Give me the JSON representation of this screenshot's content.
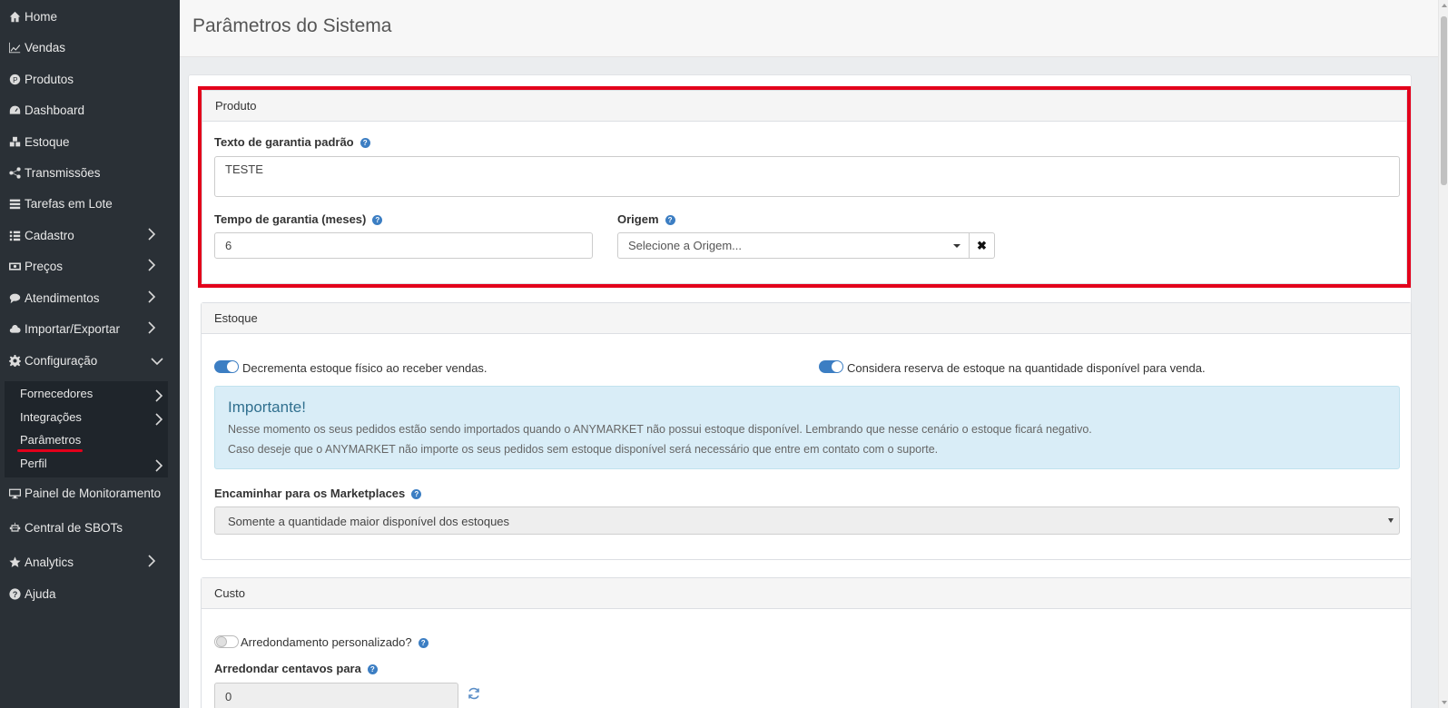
{
  "sidebar": {
    "items": [
      {
        "label": "Home",
        "icon": "home-icon"
      },
      {
        "label": "Vendas",
        "icon": "chart-line-icon"
      },
      {
        "label": "Produtos",
        "icon": "product-icon"
      },
      {
        "label": "Dashboard",
        "icon": "dashboard-icon"
      },
      {
        "label": "Estoque",
        "icon": "cubes-icon"
      },
      {
        "label": "Transmissões",
        "icon": "share-icon"
      },
      {
        "label": "Tarefas em Lote",
        "icon": "list-icon"
      },
      {
        "label": "Cadastro",
        "icon": "list-ul-icon"
      },
      {
        "label": "Preços",
        "icon": "money-icon"
      },
      {
        "label": "Atendimentos",
        "icon": "comment-icon"
      },
      {
        "label": "Importar/Exportar",
        "icon": "cloud-icon"
      },
      {
        "label": "Configuração",
        "icon": "gear-icon"
      },
      {
        "label": "Painel de Monitoramento",
        "icon": "monitor-icon"
      },
      {
        "label": "Central de SBOTs",
        "icon": "robot-icon"
      },
      {
        "label": "Analytics",
        "icon": "star-icon"
      },
      {
        "label": "Ajuda",
        "icon": "question-icon"
      }
    ],
    "submenu": [
      {
        "label": "Fornecedores"
      },
      {
        "label": "Integrações"
      },
      {
        "label": "Parâmetros"
      },
      {
        "label": "Perfil"
      }
    ]
  },
  "header": {
    "title": "Parâmetros do Sistema"
  },
  "produto": {
    "heading": "Produto",
    "garantia_texto_label": "Texto de garantia padrão",
    "garantia_texto_value": "TESTE",
    "tempo_garantia_label": "Tempo de garantia (meses)",
    "tempo_garantia_value": "6",
    "origem_label": "Origem",
    "origem_placeholder": "Selecione a Origem..."
  },
  "estoque": {
    "heading": "Estoque",
    "toggle1_label": "Decrementa estoque físico ao receber vendas.",
    "toggle2_label": "Considera reserva de estoque na quantidade disponível para venda.",
    "alert_title": "Importante!",
    "alert_line1": "Nesse momento os seus pedidos estão sendo importados quando o ANYMARKET não possui estoque disponível. Lembrando que nesse cenário o estoque ficará negativo.",
    "alert_line2": "Caso deseje que o ANYMARKET não importe os seus pedidos sem estoque disponível será necessário que entre em contato com o suporte.",
    "encaminhar_label": "Encaminhar para os Marketplaces",
    "encaminhar_value": "Somente a quantidade maior disponível dos estoques"
  },
  "custo": {
    "heading": "Custo",
    "arredondamento_label": "Arredondamento personalizado?",
    "centavos_label": "Arredondar centavos para",
    "centavos_value": "0"
  }
}
